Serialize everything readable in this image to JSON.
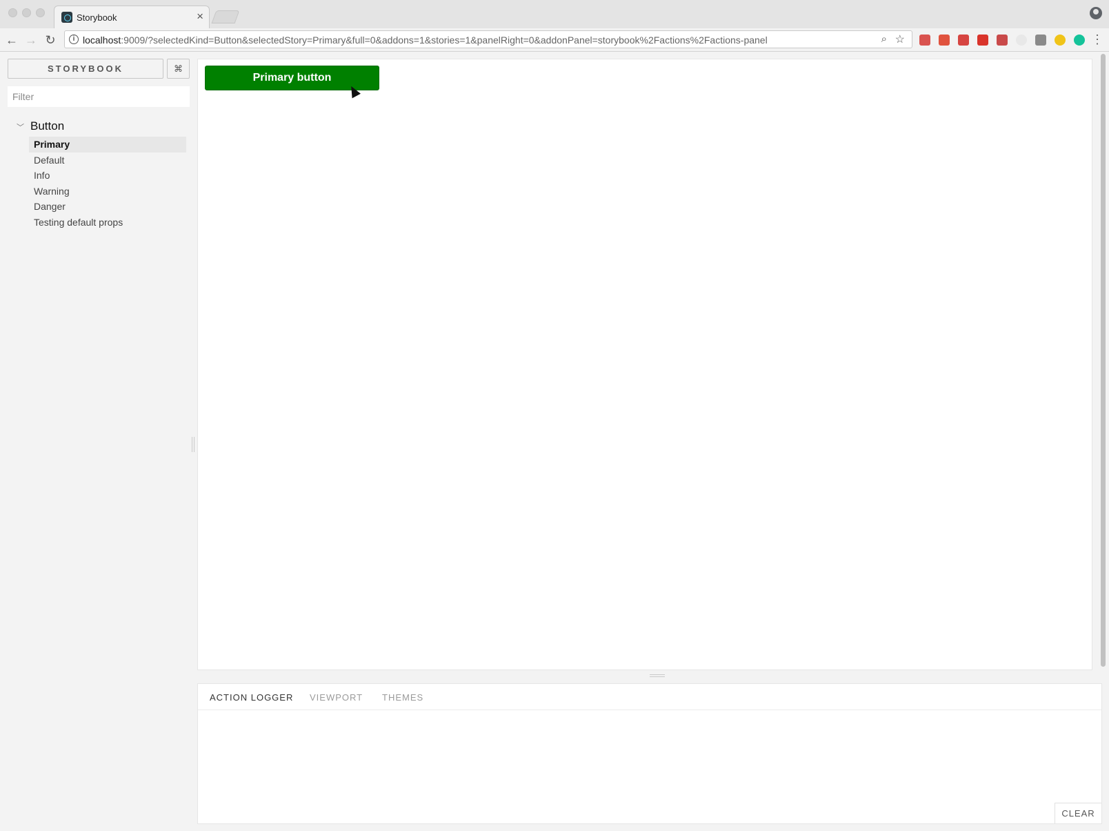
{
  "browser": {
    "tab_title": "Storybook",
    "tab_close": "×",
    "url_host": "localhost",
    "url_rest": ":9009/?selectedKind=Button&selectedStory=Primary&full=0&addons=1&stories=1&panelRight=0&addonPanel=storybook%2Factions%2Factions-panel",
    "back_glyph": "←",
    "forward_glyph": "→",
    "reload_glyph": "↻",
    "info_glyph": "i",
    "zoom_glyph": "⌕",
    "star_glyph": "☆",
    "menu_glyph": "⋮",
    "extension_icons": [
      "calendar-extension-icon",
      "opera-extension-icon",
      "shield-extension-icon",
      "adblock-extension-icon",
      "image-extension-icon",
      "circle-extension-icon",
      "evernote-extension-icon",
      "moon-extension-icon",
      "grammarly-extension-icon"
    ],
    "extension_colors": [
      "#d9534f",
      "#e0533e",
      "#d64541",
      "#d9342b",
      "#c94a4a",
      "#e8e8e8",
      "#8a8a8a",
      "#f0c419",
      "#15c39a"
    ]
  },
  "sidebar": {
    "brand": "STORYBOOK",
    "shortcuts_glyph": "⌘",
    "filter_placeholder": "Filter",
    "kind_chevron": "﹀",
    "kind": "Button",
    "stories": [
      {
        "label": "Primary",
        "selected": true
      },
      {
        "label": "Default",
        "selected": false
      },
      {
        "label": "Info",
        "selected": false
      },
      {
        "label": "Warning",
        "selected": false
      },
      {
        "label": "Danger",
        "selected": false
      },
      {
        "label": "Testing default props",
        "selected": false
      }
    ]
  },
  "preview": {
    "button_label": "Primary button",
    "button_color": "#008000"
  },
  "addons": {
    "tabs": [
      {
        "label": "ACTION LOGGER",
        "active": true
      },
      {
        "label": "VIEWPORT",
        "active": false
      },
      {
        "label": "THEMES",
        "active": false
      }
    ],
    "clear_label": "CLEAR"
  }
}
